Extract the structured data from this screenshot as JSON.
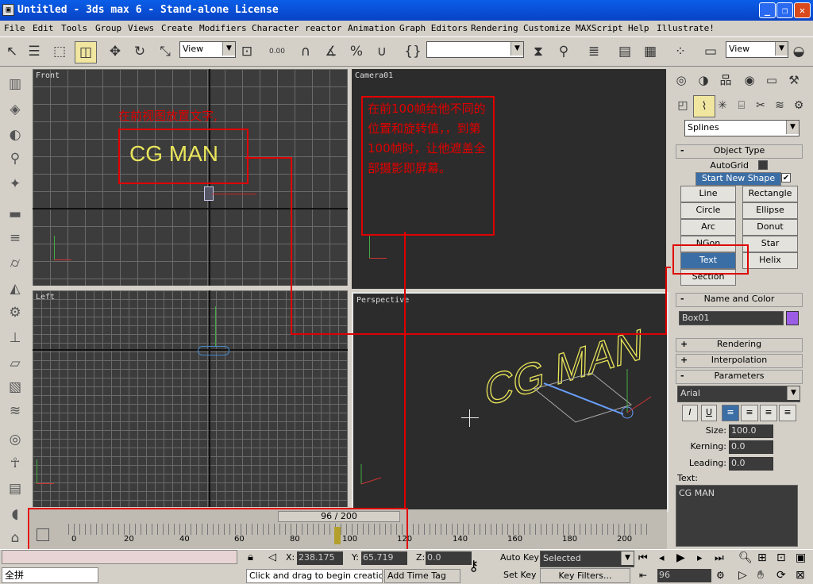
{
  "window": {
    "title": "Untitled - 3ds max 6 - Stand-alone License",
    "app_icon": "3ds-max-icon"
  },
  "menu": [
    "File",
    "Edit",
    "Tools",
    "Group",
    "Views",
    "Create",
    "Modifiers",
    "Character",
    "reactor",
    "Animation",
    "Graph Editors",
    "Rendering",
    "Customize",
    "MAXScript",
    "Help",
    "Illustrate!"
  ],
  "toolbar": {
    "ref_coord": "View",
    "angle_snap": "0.00",
    "named_selection": "",
    "view_combo": "View"
  },
  "viewports": {
    "front": {
      "label": "Front"
    },
    "camera": {
      "label": "Camera01"
    },
    "left": {
      "label": "Left"
    },
    "perspective": {
      "label": "Perspective"
    },
    "text_object": "CG MAN"
  },
  "annotations": {
    "front_note": "在前视图放置文字,",
    "camera_note": "在前100帧给他不同的位置和旋转值，，到第100帧时，让他遮盖全部摄影即屏幕。"
  },
  "command_panel": {
    "category": "Splines",
    "object_type": {
      "title": "Object Type",
      "autogrid": "AutoGrid",
      "start_new_shape": "Start New Shape",
      "buttons": [
        "Line",
        "Rectangle",
        "Circle",
        "Ellipse",
        "Arc",
        "Donut",
        "NGon",
        "Star",
        "Text",
        "Helix",
        "Section"
      ],
      "active": "Text"
    },
    "name_and_color": {
      "title": "Name and Color",
      "name": "Box01",
      "color": "#9b5ce6"
    },
    "rollouts": {
      "rendering": "Rendering",
      "interpolation": "Interpolation",
      "parameters": "Parameters"
    },
    "parameters": {
      "font": "Arial",
      "size_label": "Size:",
      "size": "100.0",
      "kerning_label": "Kerning:",
      "kerning": "0.0",
      "leading_label": "Leading:",
      "leading": "0.0",
      "text_label": "Text:",
      "text": "CG MAN",
      "style_buttons": [
        "I",
        "U"
      ]
    }
  },
  "timeline": {
    "frame_display": "96 / 200",
    "ticks": [
      "0",
      "20",
      "40",
      "60",
      "80",
      "100",
      "120",
      "140",
      "160",
      "180",
      "200"
    ]
  },
  "statusbar": {
    "x_label": "X:",
    "x": "238.175",
    "y_label": "Y:",
    "y": "65.719",
    "z_label": "Z:",
    "z": "0.0",
    "prompt": "Click and drag to begin creation pro",
    "add_time_tag": "Add Time Tag",
    "auto_key": "Auto Key",
    "set_key": "Set Key",
    "key_mode": "Selected",
    "key_filters": "Key Filters...",
    "current_frame": "96",
    "ime_label": "全拼"
  }
}
